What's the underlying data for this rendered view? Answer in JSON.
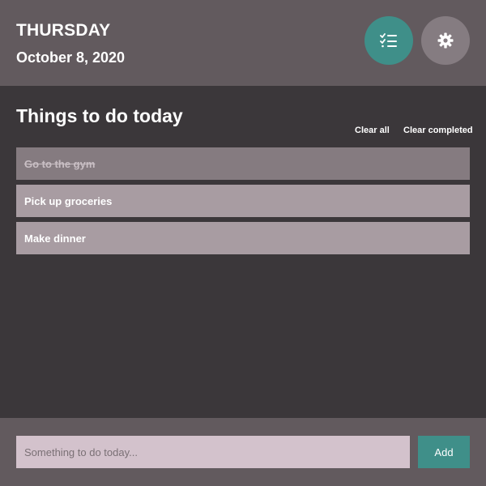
{
  "header": {
    "day": "THURSDAY",
    "date": "October 8, 2020",
    "list_button_icon": "checklist-icon",
    "settings_button_icon": "gear-icon"
  },
  "main": {
    "title": "Things to do today",
    "clear_all_label": "Clear all",
    "clear_completed_label": "Clear completed",
    "todos": [
      {
        "text": "Go to the gym",
        "completed": true
      },
      {
        "text": "Pick up groceries",
        "completed": false
      },
      {
        "text": "Make dinner",
        "completed": false
      }
    ]
  },
  "footer": {
    "input_placeholder": "Something to do today...",
    "input_value": "",
    "add_label": "Add"
  },
  "colors": {
    "header_bg": "#625a5e",
    "main_bg": "#3b373a",
    "accent": "#3f8f89",
    "todo_bg": "#a89ca2",
    "todo_completed_bg": "#857b80",
    "input_bg": "#d3c2cc"
  }
}
